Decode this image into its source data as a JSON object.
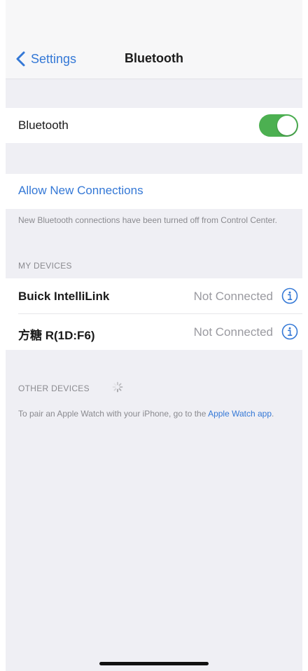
{
  "nav": {
    "back_label": "Settings",
    "title": "Bluetooth"
  },
  "bluetooth_toggle": {
    "label": "Bluetooth",
    "state": "on",
    "on_color": "#4cb051"
  },
  "allow_connections": {
    "label": "Allow New Connections",
    "footer": "New Bluetooth connections have been turned off from Control Center."
  },
  "my_devices": {
    "header": "MY DEVICES",
    "items": [
      {
        "name": "Buick IntelliLink",
        "status": "Not Connected"
      },
      {
        "name": "方糖 R(1D:F6)",
        "status": "Not Connected"
      }
    ]
  },
  "other_devices": {
    "header": "OTHER DEVICES",
    "footer_prefix": "To pair an Apple Watch with your iPhone, go to the ",
    "footer_link": "Apple Watch app",
    "footer_suffix": "."
  },
  "icons": {
    "back": "chevron-left-icon",
    "info": "info-circle-icon",
    "spinner": "activity-spinner-icon"
  },
  "colors": {
    "accent": "#3478d6",
    "background": "#efeff4",
    "secondary_text": "#8a8a8f"
  }
}
